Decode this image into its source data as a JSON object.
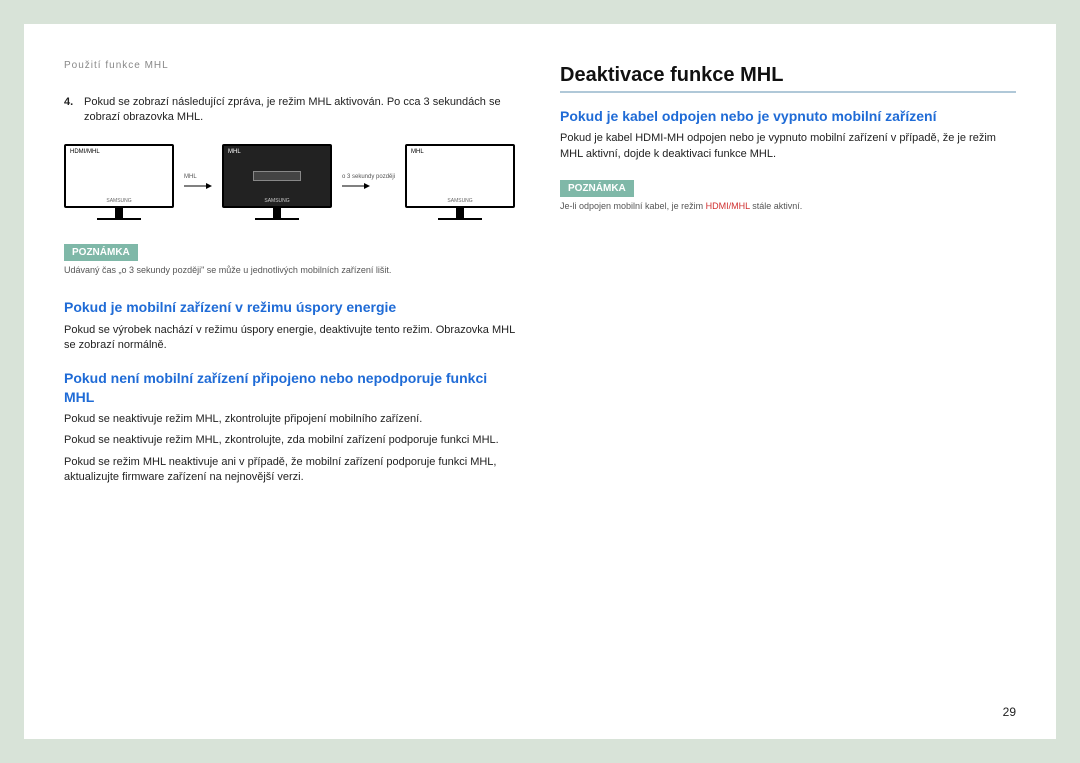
{
  "breadcrumb": "Použití funkce MHL",
  "step4": {
    "num": "4.",
    "text": "Pokud se zobrazí následující zpráva, je režim MHL aktivován. Po cca 3 sekundách se zobrazí obrazovka MHL."
  },
  "diagram": {
    "screen1_label": "HDMI/MHL",
    "arrow1_label": "MHL",
    "screen2_label": "MHL",
    "arrow2_label": "o 3 sekundy později",
    "screen3_label": "MHL",
    "brand": "SAMSUNG"
  },
  "left": {
    "note_label": "POZNÁMKA",
    "note_text": "Udávaný čas „o 3 sekundy později\" se může u jednotlivých mobilních zařízení lišit.",
    "h2a": "Pokud je mobilní zařízení v režimu úspory energie",
    "p_a": "Pokud se výrobek nachází v režimu úspory energie, deaktivujte tento režim. Obrazovka MHL se zobrazí normálně.",
    "h2b": "Pokud není mobilní zařízení připojeno nebo nepodporuje funkci MHL",
    "p_b1": "Pokud se neaktivuje režim MHL, zkontrolujte připojení mobilního zařízení.",
    "p_b2": "Pokud se neaktivuje režim MHL, zkontrolujte, zda mobilní zařízení podporuje funkci MHL.",
    "p_b3": "Pokud se režim MHL neaktivuje ani v případě, že mobilní zařízení podporuje funkci MHL, aktualizujte firmware zařízení na nejnovější verzi."
  },
  "right": {
    "h1": "Deaktivace funkce MHL",
    "h2": "Pokud je kabel odpojen nebo je vypnuto mobilní zařízení",
    "p1": "Pokud je kabel HDMI-MH odpojen nebo je vypnuto mobilní zařízení v případě, že je režim MHL aktivní, dojde k deaktivaci funkce MHL.",
    "note_label": "POZNÁMKA",
    "note_pre": "Je-li odpojen mobilní kabel, je režim ",
    "note_red": "HDMI/MHL",
    "note_post": " stále aktivní."
  },
  "page_number": "29"
}
